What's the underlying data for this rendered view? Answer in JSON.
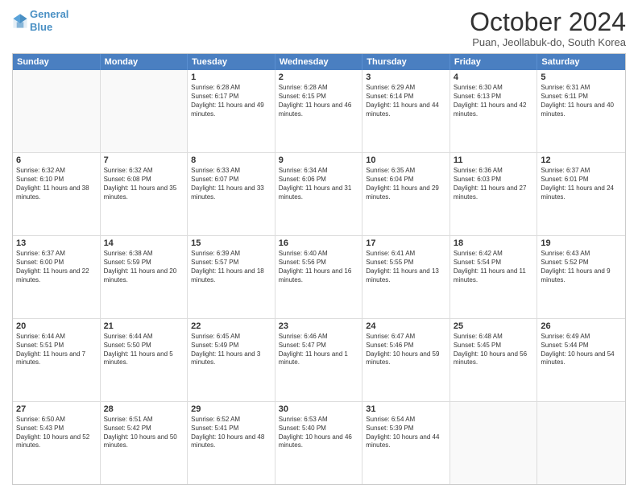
{
  "header": {
    "logo_line1": "General",
    "logo_line2": "Blue",
    "title": "October 2024",
    "location": "Puan, Jeollabuk-do, South Korea"
  },
  "days_of_week": [
    "Sunday",
    "Monday",
    "Tuesday",
    "Wednesday",
    "Thursday",
    "Friday",
    "Saturday"
  ],
  "weeks": [
    [
      {
        "day": "",
        "content": ""
      },
      {
        "day": "",
        "content": ""
      },
      {
        "day": "1",
        "content": "Sunrise: 6:28 AM\nSunset: 6:17 PM\nDaylight: 11 hours and 49 minutes."
      },
      {
        "day": "2",
        "content": "Sunrise: 6:28 AM\nSunset: 6:15 PM\nDaylight: 11 hours and 46 minutes."
      },
      {
        "day": "3",
        "content": "Sunrise: 6:29 AM\nSunset: 6:14 PM\nDaylight: 11 hours and 44 minutes."
      },
      {
        "day": "4",
        "content": "Sunrise: 6:30 AM\nSunset: 6:13 PM\nDaylight: 11 hours and 42 minutes."
      },
      {
        "day": "5",
        "content": "Sunrise: 6:31 AM\nSunset: 6:11 PM\nDaylight: 11 hours and 40 minutes."
      }
    ],
    [
      {
        "day": "6",
        "content": "Sunrise: 6:32 AM\nSunset: 6:10 PM\nDaylight: 11 hours and 38 minutes."
      },
      {
        "day": "7",
        "content": "Sunrise: 6:32 AM\nSunset: 6:08 PM\nDaylight: 11 hours and 35 minutes."
      },
      {
        "day": "8",
        "content": "Sunrise: 6:33 AM\nSunset: 6:07 PM\nDaylight: 11 hours and 33 minutes."
      },
      {
        "day": "9",
        "content": "Sunrise: 6:34 AM\nSunset: 6:06 PM\nDaylight: 11 hours and 31 minutes."
      },
      {
        "day": "10",
        "content": "Sunrise: 6:35 AM\nSunset: 6:04 PM\nDaylight: 11 hours and 29 minutes."
      },
      {
        "day": "11",
        "content": "Sunrise: 6:36 AM\nSunset: 6:03 PM\nDaylight: 11 hours and 27 minutes."
      },
      {
        "day": "12",
        "content": "Sunrise: 6:37 AM\nSunset: 6:01 PM\nDaylight: 11 hours and 24 minutes."
      }
    ],
    [
      {
        "day": "13",
        "content": "Sunrise: 6:37 AM\nSunset: 6:00 PM\nDaylight: 11 hours and 22 minutes."
      },
      {
        "day": "14",
        "content": "Sunrise: 6:38 AM\nSunset: 5:59 PM\nDaylight: 11 hours and 20 minutes."
      },
      {
        "day": "15",
        "content": "Sunrise: 6:39 AM\nSunset: 5:57 PM\nDaylight: 11 hours and 18 minutes."
      },
      {
        "day": "16",
        "content": "Sunrise: 6:40 AM\nSunset: 5:56 PM\nDaylight: 11 hours and 16 minutes."
      },
      {
        "day": "17",
        "content": "Sunrise: 6:41 AM\nSunset: 5:55 PM\nDaylight: 11 hours and 13 minutes."
      },
      {
        "day": "18",
        "content": "Sunrise: 6:42 AM\nSunset: 5:54 PM\nDaylight: 11 hours and 11 minutes."
      },
      {
        "day": "19",
        "content": "Sunrise: 6:43 AM\nSunset: 5:52 PM\nDaylight: 11 hours and 9 minutes."
      }
    ],
    [
      {
        "day": "20",
        "content": "Sunrise: 6:44 AM\nSunset: 5:51 PM\nDaylight: 11 hours and 7 minutes."
      },
      {
        "day": "21",
        "content": "Sunrise: 6:44 AM\nSunset: 5:50 PM\nDaylight: 11 hours and 5 minutes."
      },
      {
        "day": "22",
        "content": "Sunrise: 6:45 AM\nSunset: 5:49 PM\nDaylight: 11 hours and 3 minutes."
      },
      {
        "day": "23",
        "content": "Sunrise: 6:46 AM\nSunset: 5:47 PM\nDaylight: 11 hours and 1 minute."
      },
      {
        "day": "24",
        "content": "Sunrise: 6:47 AM\nSunset: 5:46 PM\nDaylight: 10 hours and 59 minutes."
      },
      {
        "day": "25",
        "content": "Sunrise: 6:48 AM\nSunset: 5:45 PM\nDaylight: 10 hours and 56 minutes."
      },
      {
        "day": "26",
        "content": "Sunrise: 6:49 AM\nSunset: 5:44 PM\nDaylight: 10 hours and 54 minutes."
      }
    ],
    [
      {
        "day": "27",
        "content": "Sunrise: 6:50 AM\nSunset: 5:43 PM\nDaylight: 10 hours and 52 minutes."
      },
      {
        "day": "28",
        "content": "Sunrise: 6:51 AM\nSunset: 5:42 PM\nDaylight: 10 hours and 50 minutes."
      },
      {
        "day": "29",
        "content": "Sunrise: 6:52 AM\nSunset: 5:41 PM\nDaylight: 10 hours and 48 minutes."
      },
      {
        "day": "30",
        "content": "Sunrise: 6:53 AM\nSunset: 5:40 PM\nDaylight: 10 hours and 46 minutes."
      },
      {
        "day": "31",
        "content": "Sunrise: 6:54 AM\nSunset: 5:39 PM\nDaylight: 10 hours and 44 minutes."
      },
      {
        "day": "",
        "content": ""
      },
      {
        "day": "",
        "content": ""
      }
    ]
  ]
}
